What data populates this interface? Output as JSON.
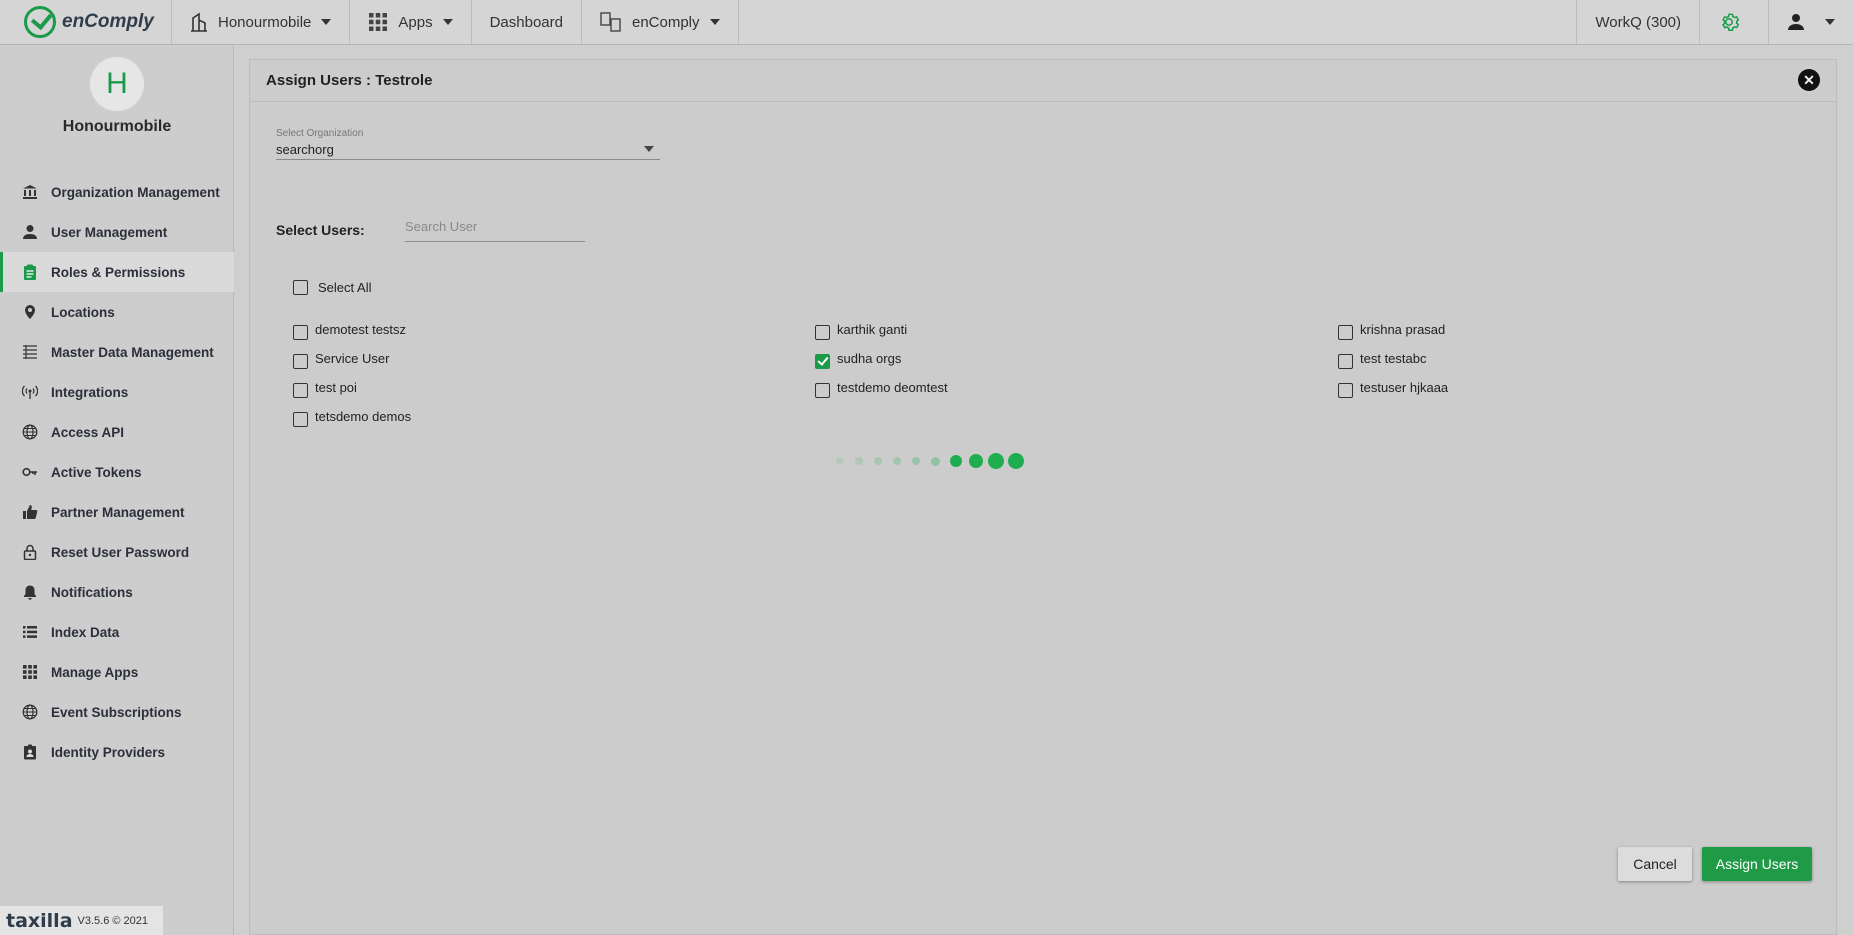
{
  "header": {
    "brand": "enComply",
    "org_menu": "Honourmobile",
    "apps_menu": "Apps",
    "dashboard": "Dashboard",
    "app_switch": "enComply",
    "workq": "WorkQ (300)"
  },
  "sidebar": {
    "avatar_letter": "H",
    "org_name": "Honourmobile",
    "items": [
      {
        "label": "Organization Management",
        "icon": "bank-icon"
      },
      {
        "label": "User Management",
        "icon": "person-icon"
      },
      {
        "label": "Roles & Permissions",
        "icon": "clipboard-icon",
        "active": true
      },
      {
        "label": "Locations",
        "icon": "location-pin-icon"
      },
      {
        "label": "Master Data Management",
        "icon": "list-icon"
      },
      {
        "label": "Integrations",
        "icon": "antenna-icon"
      },
      {
        "label": "Access API",
        "icon": "globe-icon"
      },
      {
        "label": "Active Tokens",
        "icon": "key-icon"
      },
      {
        "label": "Partner Management",
        "icon": "thumbs-up-icon"
      },
      {
        "label": "Reset User Password",
        "icon": "lock-icon"
      },
      {
        "label": "Notifications",
        "icon": "bell-icon"
      },
      {
        "label": "Index Data",
        "icon": "list-icon"
      },
      {
        "label": "Manage Apps",
        "icon": "grid-icon"
      },
      {
        "label": "Event Subscriptions",
        "icon": "globe-icon"
      },
      {
        "label": "Identity Providers",
        "icon": "id-badge-icon"
      }
    ],
    "footer_logo": "taxilla",
    "footer_version": "V3.5.6 © 2021"
  },
  "dialog": {
    "title": "Assign Users : Testrole",
    "org_label": "Select Organization",
    "org_value": "searchorg",
    "users_label": "Select Users:",
    "search_placeholder": "Search User",
    "select_all": "Select All",
    "users": [
      {
        "name": "demotest testsz",
        "checked": false
      },
      {
        "name": "karthik ganti",
        "checked": false
      },
      {
        "name": "krishna prasad",
        "checked": false
      },
      {
        "name": "Service User",
        "checked": false
      },
      {
        "name": "sudha orgs",
        "checked": true
      },
      {
        "name": "test testabc",
        "checked": false
      },
      {
        "name": "test poi",
        "checked": false
      },
      {
        "name": "testdemo deomtest",
        "checked": false
      },
      {
        "name": "testuser hjkaaa",
        "checked": false
      },
      {
        "name": "tetsdemo demos",
        "checked": false
      }
    ],
    "cancel": "Cancel",
    "assign": "Assign Users"
  },
  "colors": {
    "accent": "#1b9a4a",
    "background": "#cfcfcf"
  }
}
